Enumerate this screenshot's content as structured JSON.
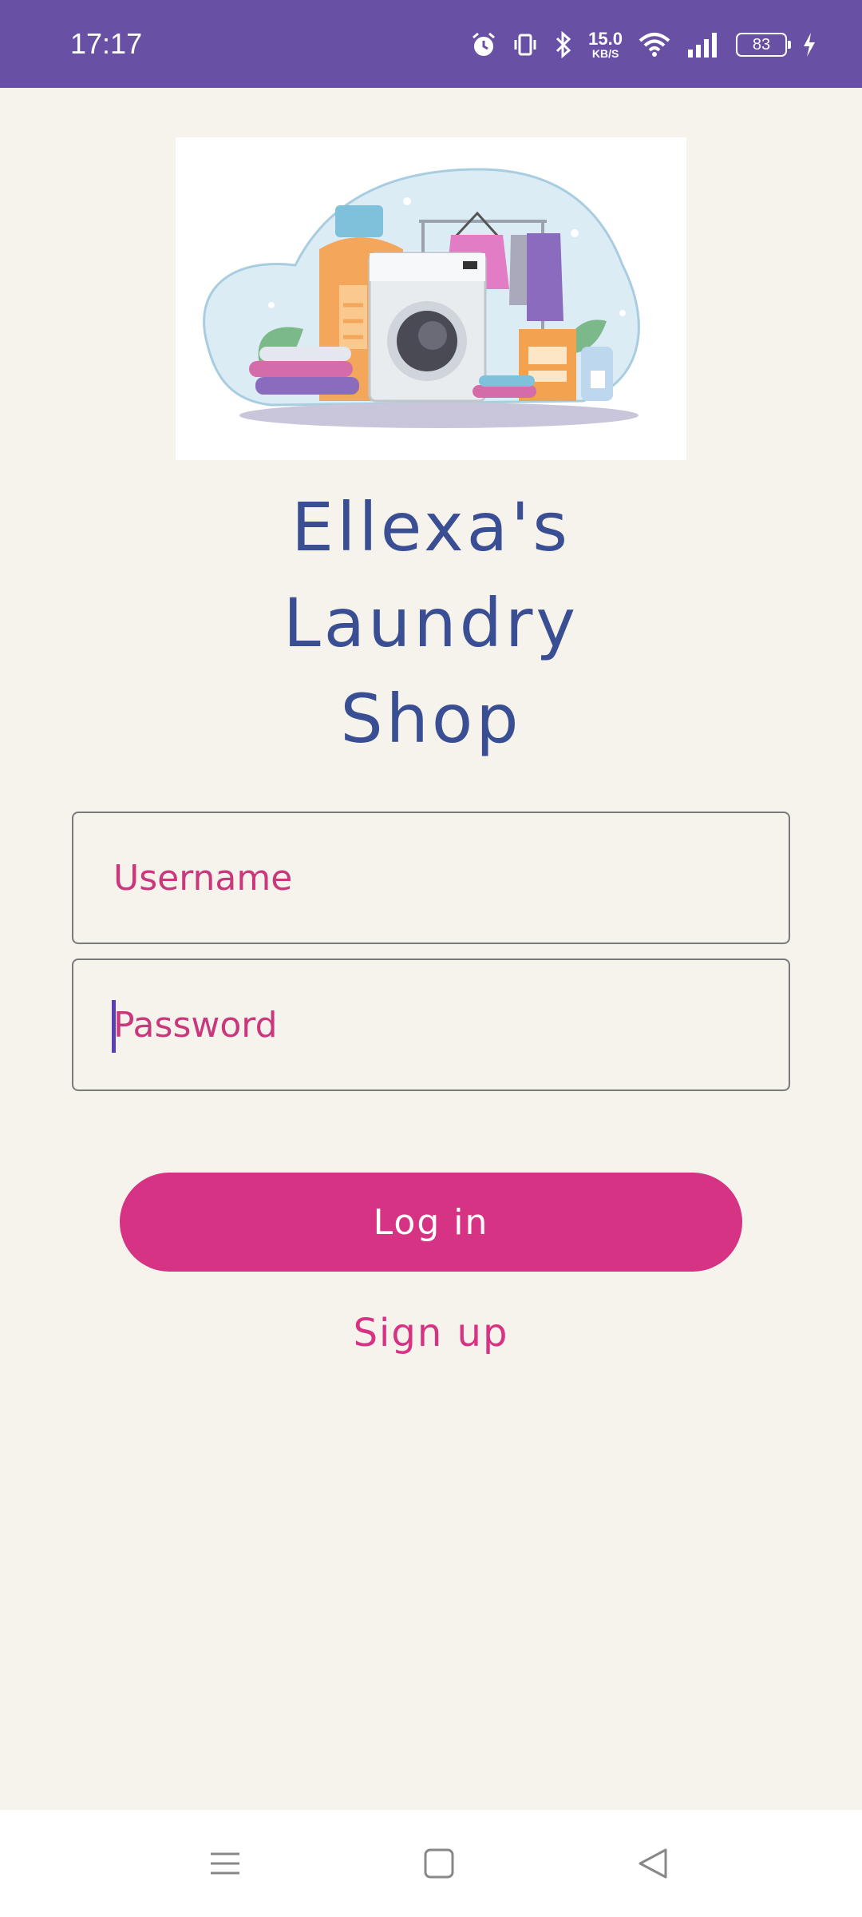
{
  "status_bar": {
    "time": "17:17",
    "net_speed_value": "15.0",
    "net_speed_unit": "KB/S",
    "battery_level": "83",
    "icons": [
      "alarm-icon",
      "vibrate-icon",
      "bluetooth-icon",
      "wifi-icon",
      "signal-icon",
      "battery-icon",
      "charging-icon"
    ]
  },
  "hero": {
    "illustration": "laundry-illustration"
  },
  "title": {
    "line1": "Ellexa's",
    "line2": "Laundry",
    "line3": "Shop"
  },
  "form": {
    "username_placeholder": "Username",
    "username_value": "",
    "password_placeholder": "Password",
    "password_value": ""
  },
  "actions": {
    "login_label": "Log in",
    "signup_label": "Sign up"
  },
  "colors": {
    "status_bar": "#6850a4",
    "background": "#f6f2ec",
    "title": "#3a4f93",
    "accent": "#d63384",
    "caret": "#5a3fb5"
  },
  "nav_bar": {
    "icons": [
      "menu-icon",
      "home-icon",
      "back-icon"
    ]
  }
}
